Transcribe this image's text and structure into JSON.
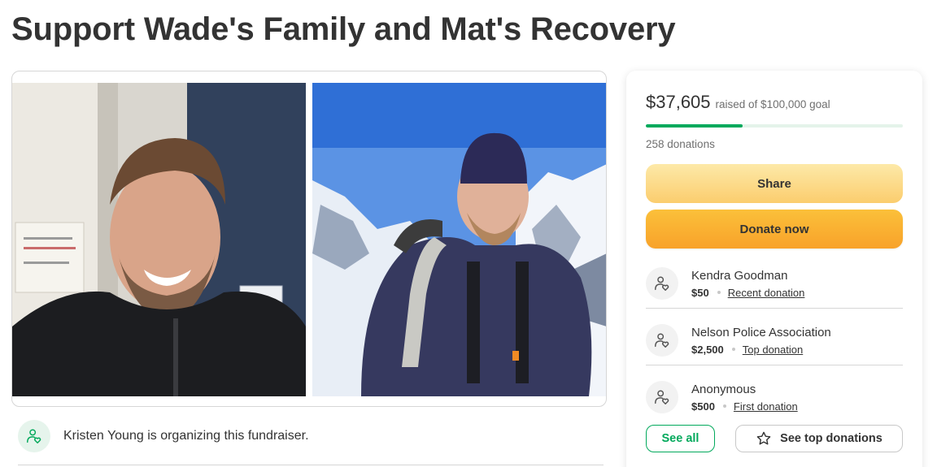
{
  "page": {
    "title": "Support Wade's Family and Mat's Recovery"
  },
  "photos": {
    "left_alt": "Smiling man with beard in black jacket",
    "right_alt": "Smiling man in beanie with backpack on snowy mountain"
  },
  "organizer": {
    "text": "Kristen Young is organizing this fundraiser.",
    "icon": "heart-person-icon"
  },
  "summary": {
    "amount": "$37,605",
    "goal_text": "raised of $100,000 goal",
    "progress_fraction": 0.376,
    "donations_count": "258 donations",
    "share_label": "Share",
    "donate_label": "Donate now",
    "see_all_label": "See all",
    "see_top_label": "See top donations"
  },
  "donors": [
    {
      "name": "Kendra Goodman",
      "amount": "$50",
      "tag": "Recent donation"
    },
    {
      "name": "Nelson Police Association",
      "amount": "$2,500",
      "tag": "Top donation"
    },
    {
      "name": "Anonymous",
      "amount": "$500",
      "tag": "First donation"
    }
  ],
  "colors": {
    "accent_green": "#02a95c",
    "donate_orange": "#f8a22a",
    "share_yellow": "#fbcd6e"
  }
}
